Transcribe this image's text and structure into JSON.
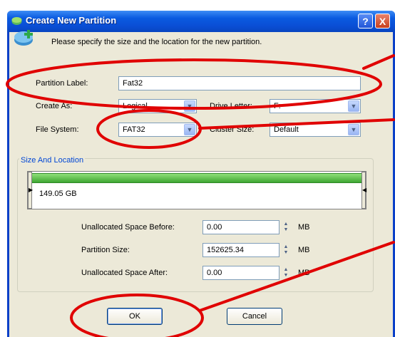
{
  "window": {
    "title": "Create New Partition",
    "help_glyph": "?",
    "close_glyph": "X",
    "intro": "Please specify the size and the location for the new partition."
  },
  "form": {
    "partition_label": {
      "label": "Partition Label:",
      "value": "Fat32"
    },
    "create_as": {
      "label": "Create As:",
      "value": "Logical"
    },
    "drive_letter": {
      "label": "Drive Letter:",
      "value": "F:"
    },
    "file_system": {
      "label": "File System:",
      "value": "FAT32"
    },
    "cluster_size": {
      "label": "Cluster Size:",
      "value": "Default"
    }
  },
  "size_location": {
    "title": "Size And Location",
    "disk_size": "149.05 GB",
    "unallocated_before": {
      "label": "Unallocated Space Before:",
      "value": "0.00",
      "unit": "MB"
    },
    "partition_size": {
      "label": "Partition Size:",
      "value": "152625.34",
      "unit": "MB"
    },
    "unallocated_after": {
      "label": "Unallocated Space After:",
      "value": "0.00",
      "unit": "MB"
    }
  },
  "buttons": {
    "ok": "OK",
    "cancel": "Cancel"
  },
  "colors": {
    "title_bar": "#0a5ae0",
    "dialog_bg": "#ece9d8",
    "partition_fill": "#3ea632",
    "annotation": "#e00000"
  },
  "icons": {
    "window_icon": "partition-icon",
    "header_icon": "add-partition-icon"
  }
}
